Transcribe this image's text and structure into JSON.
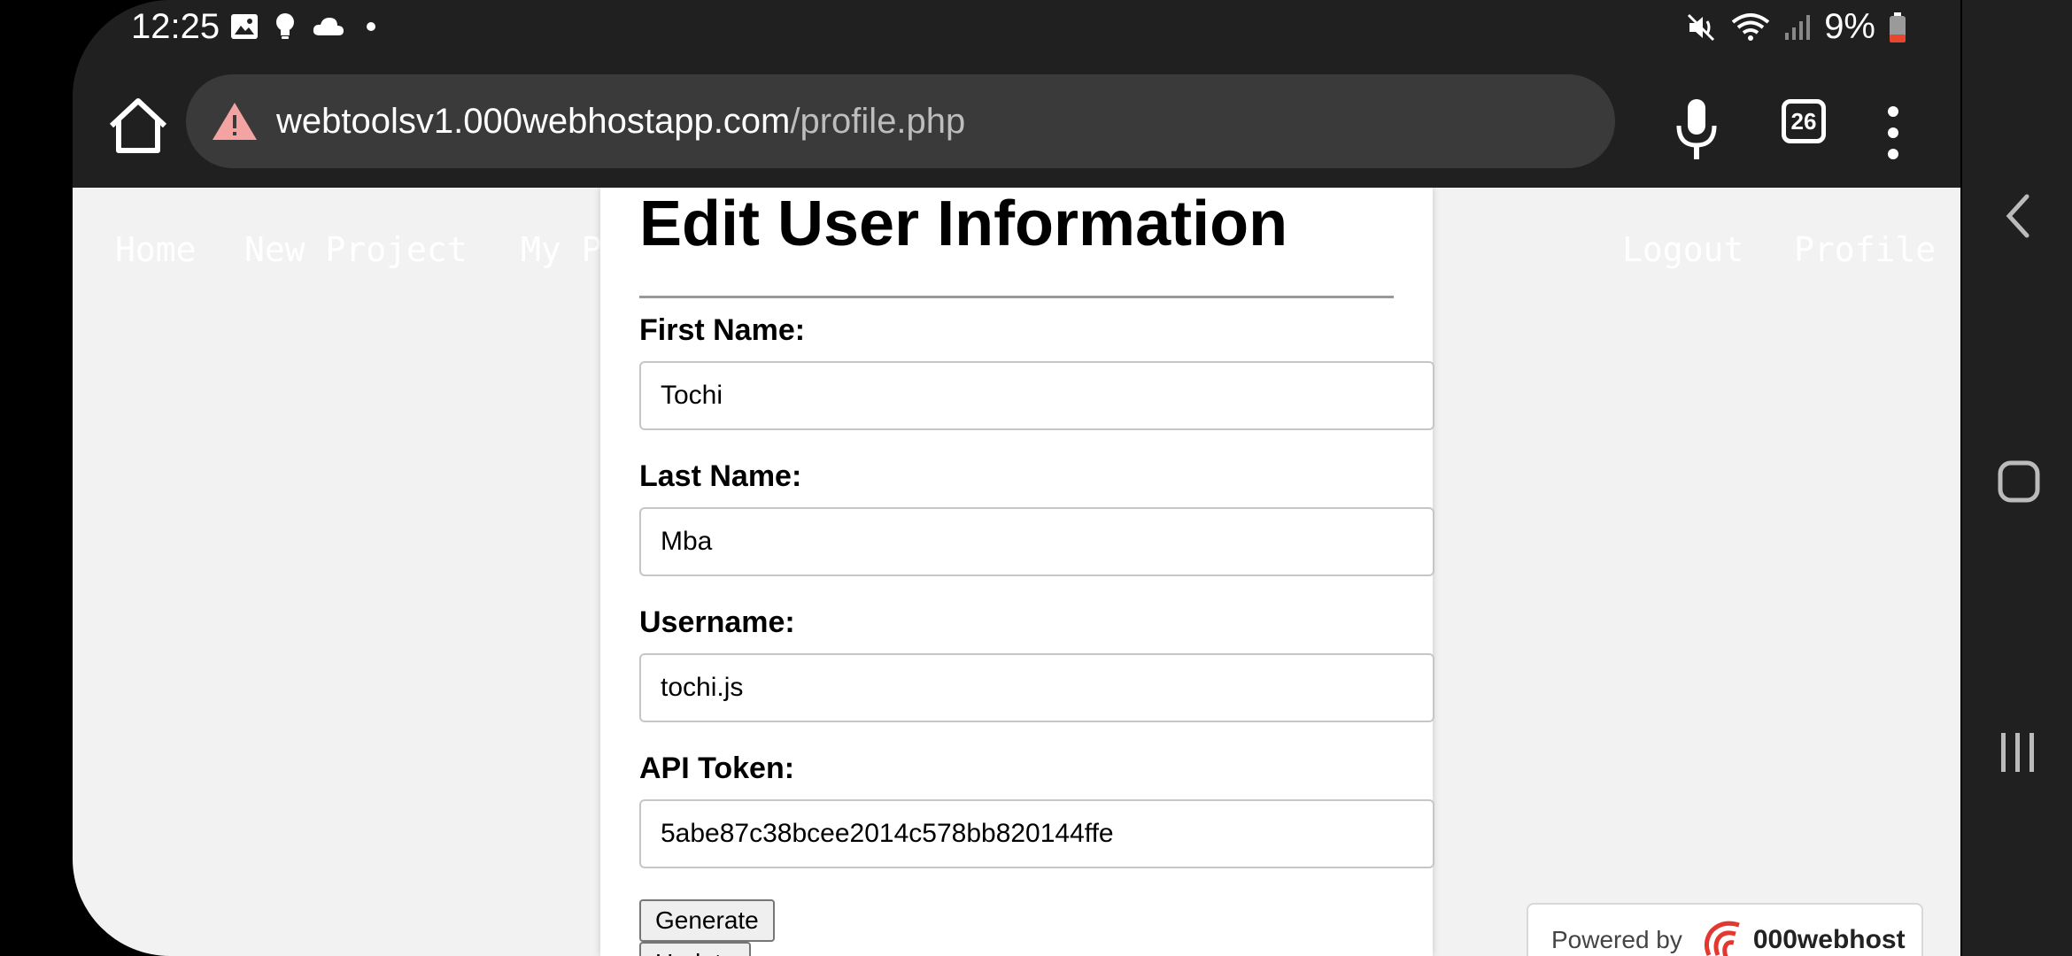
{
  "status_bar": {
    "time": "12:25",
    "left_icons": [
      "image-icon",
      "lightbulb-icon",
      "cloud-icon",
      "dot-icon"
    ],
    "right_icons": [
      "mute-icon",
      "wifi-icon",
      "signal-icon",
      "battery-icon"
    ],
    "battery": "9%"
  },
  "browser": {
    "url_domain": "webtoolsv1.000webhostapp.com",
    "url_path": "/profile.php",
    "tab_count": "26"
  },
  "page_nav": {
    "home": "Home",
    "new_project": "New Project",
    "my_partial": "My P",
    "logout": "Logout",
    "profile": "Profile"
  },
  "form": {
    "title": "Edit User Information",
    "first_name_label": "First Name:",
    "first_name_value": "Tochi",
    "last_name_label": "Last Name:",
    "last_name_value": "Mba",
    "username_label": "Username:",
    "username_value": "tochi.js",
    "api_token_label": "API Token:",
    "api_token_value": "5abe87c38bcee2014c578bb820144ffe",
    "generate_label": "Generate",
    "update_label": "Update"
  },
  "badge": {
    "powered_by": "Powered by",
    "brand": "000webhost"
  },
  "colors": {
    "warning": "#f4a3a3",
    "battery_low": "#e8462f",
    "page_bg": "#f2f2f2"
  }
}
